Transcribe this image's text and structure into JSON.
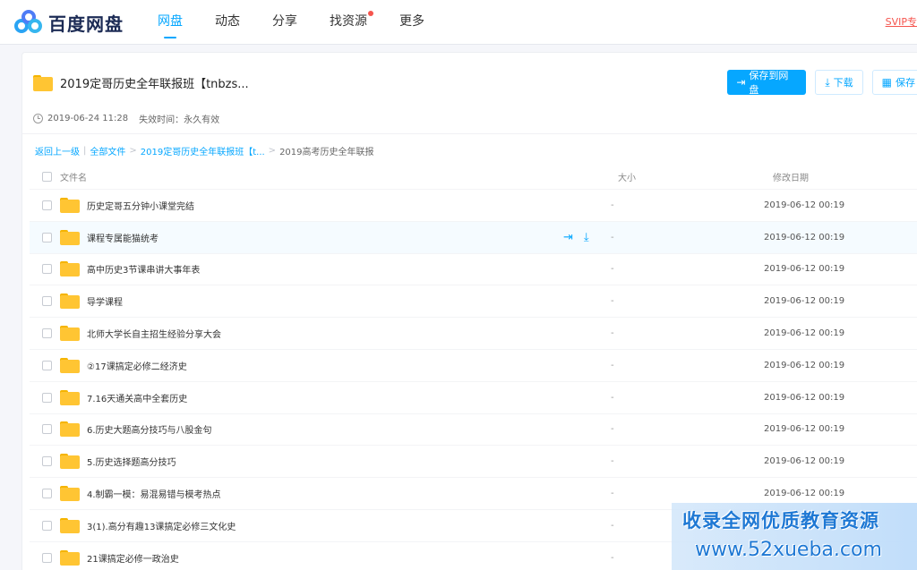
{
  "brand": {
    "name": "百度网盘"
  },
  "nav": [
    {
      "label": "网盘",
      "active": true
    },
    {
      "label": "动态"
    },
    {
      "label": "分享"
    },
    {
      "label": "找资源",
      "dot": true
    },
    {
      "label": "更多"
    }
  ],
  "header_right": {
    "svip_label": "SVIP专"
  },
  "share": {
    "title": "2019定哥历史全年联报班【tnbzs...",
    "created": "2019-06-24 11:28",
    "expire_label": "失效时间：",
    "expire_value": "永久有效"
  },
  "buttons": {
    "save_to_drive": "保存到网盘",
    "download": "下载",
    "save_short": "保存"
  },
  "breadcrumb": {
    "back": "返回上一级",
    "all_files": "全部文件",
    "folder1": "2019定哥历史全年联报班【t...",
    "current": "2019高考历史全年联报"
  },
  "table": {
    "col_name": "文件名",
    "col_size": "大小",
    "col_date": "修改日期",
    "rows": [
      {
        "name": "历史定哥五分钟小课堂完结",
        "size": "-",
        "date": "2019-06-12 00:19"
      },
      {
        "name": "课程专属能猫统考",
        "size": "-",
        "date": "2019-06-12 00:19"
      },
      {
        "name": "高中历史3节课串讲大事年表",
        "size": "-",
        "date": "2019-06-12 00:19"
      },
      {
        "name": "导学课程",
        "size": "-",
        "date": "2019-06-12 00:19"
      },
      {
        "name": "北师大学长自主招生经验分享大会",
        "size": "-",
        "date": "2019-06-12 00:19"
      },
      {
        "name": "②17课搞定必修二经济史",
        "size": "-",
        "date": "2019-06-12 00:19"
      },
      {
        "name": "7.16天通关高中全套历史",
        "size": "-",
        "date": "2019-06-12 00:19"
      },
      {
        "name": "6.历史大题高分技巧与八股金句",
        "size": "-",
        "date": "2019-06-12 00:19"
      },
      {
        "name": "5.历史选择题高分技巧",
        "size": "-",
        "date": "2019-06-12 00:19"
      },
      {
        "name": "4.制霸一模：易混易错与模考热点",
        "size": "-",
        "date": "2019-06-12 00:19"
      },
      {
        "name": "3(1).高分有趣13课搞定必修三文化史",
        "size": "-",
        "date": ""
      },
      {
        "name": "21课搞定必修一政治史",
        "size": "-",
        "date": ""
      }
    ]
  },
  "watermark": {
    "line1": "收录全网优质教育资源",
    "line2": "www.52xueba.com"
  }
}
